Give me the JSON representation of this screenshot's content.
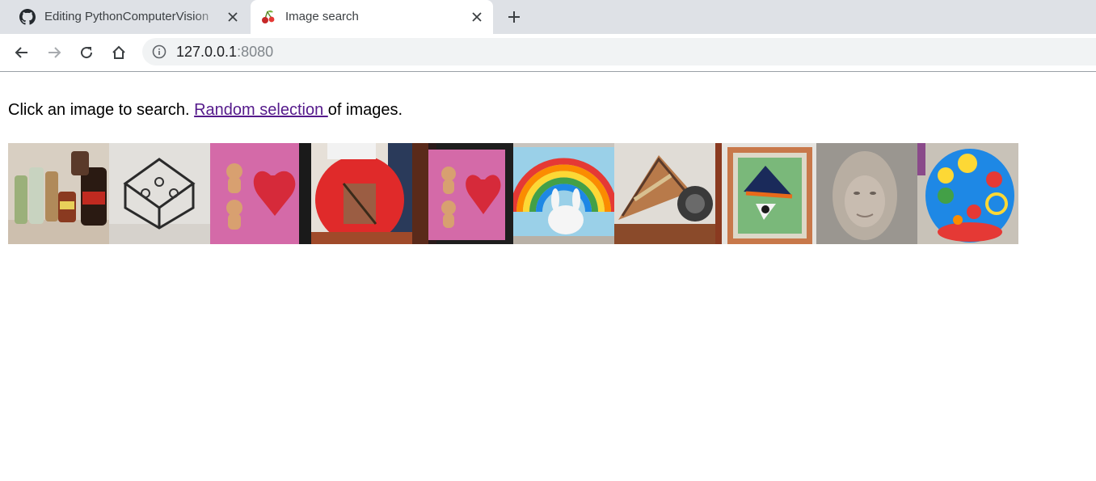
{
  "browser": {
    "tabs": [
      {
        "title": "Editing PythonComputerVision",
        "favicon": "github-icon",
        "active": false
      },
      {
        "title": "Image search",
        "favicon": "cherry-icon",
        "active": true
      }
    ],
    "address": {
      "host": "127.0.0.1",
      "port": ":8080"
    }
  },
  "page": {
    "intro_before": "Click an image to search. ",
    "link_text": "Random selection ",
    "intro_after": "of images.",
    "thumbnails": [
      {
        "subject": "bottles and jars"
      },
      {
        "subject": "wire lantern"
      },
      {
        "subject": "teddy bears and heart box"
      },
      {
        "subject": "red jar"
      },
      {
        "subject": "teddy bears and heart box"
      },
      {
        "subject": "What Makes a Rainbow? book"
      },
      {
        "subject": "tiffany lamp"
      },
      {
        "subject": "framed painting"
      },
      {
        "subject": "portrait photo"
      },
      {
        "subject": "toy activity ball"
      }
    ]
  },
  "colors": {
    "tabstrip": "#dee1e6",
    "omnibox": "#f1f3f4",
    "visited_link": "#551a8b"
  }
}
